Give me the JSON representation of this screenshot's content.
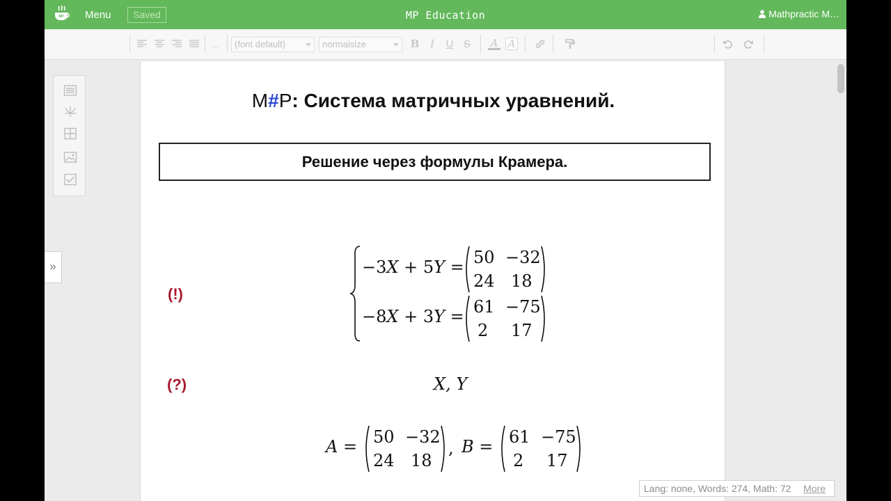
{
  "topbar": {
    "menu_label": "Menu",
    "saved_label": "Saved",
    "title": "MP Education",
    "user_label": "Mathpractic M…",
    "bg_color": "#62b85a"
  },
  "toolbar": {
    "more_label": "...",
    "font_select": "(font default)",
    "size_select": "normalsize",
    "bold_glyph": "B",
    "italic_glyph": "I",
    "underline_glyph": "U",
    "strike_glyph": "S",
    "text_color_glyph": "A",
    "highlight_glyph": "A"
  },
  "side_panel": {
    "expand_glyph": "»"
  },
  "document": {
    "title_m": "M",
    "title_hash": "#",
    "title_p": "P",
    "title_text": ": Система матричных уравнений.",
    "subtitle": "Решение через формулы Крамера.",
    "given_marker": "(!)",
    "question_marker": "(?)",
    "system": {
      "eq1_lhs": "−3X + 5Y =",
      "eq1_matrix": [
        "50",
        "−32",
        "24",
        "18"
      ],
      "eq2_lhs": "−8X + 3Y =",
      "eq2_matrix": [
        "61",
        "−75",
        "2",
        "17"
      ]
    },
    "unknowns": "X, Y",
    "defs": {
      "a_label": "A =",
      "a_matrix": [
        "50",
        "−32",
        "24",
        "18"
      ],
      "separator": ",",
      "b_label": "B =",
      "b_matrix": [
        "61",
        "−75",
        "2",
        "17"
      ]
    },
    "marker_color": "#a8192e",
    "brand_color": "#2a46d4"
  },
  "status_bar": {
    "text": "Lang: none, Words: 274, Math: 72",
    "more_label": "More"
  }
}
